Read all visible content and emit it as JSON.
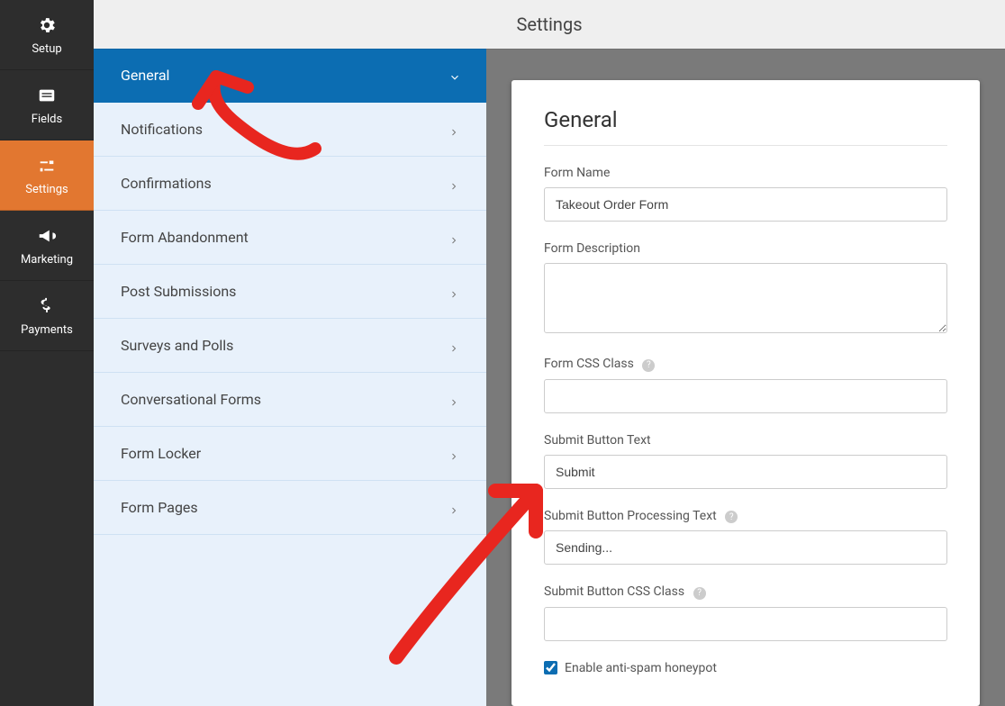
{
  "topbar": {
    "title": "Settings"
  },
  "nav": {
    "items": [
      {
        "label": "Setup"
      },
      {
        "label": "Fields"
      },
      {
        "label": "Settings"
      },
      {
        "label": "Marketing"
      },
      {
        "label": "Payments"
      }
    ]
  },
  "settingsMenu": {
    "items": [
      {
        "label": "General"
      },
      {
        "label": "Notifications"
      },
      {
        "label": "Confirmations"
      },
      {
        "label": "Form Abandonment"
      },
      {
        "label": "Post Submissions"
      },
      {
        "label": "Surveys and Polls"
      },
      {
        "label": "Conversational Forms"
      },
      {
        "label": "Form Locker"
      },
      {
        "label": "Form Pages"
      }
    ]
  },
  "panel": {
    "heading": "General",
    "formName": {
      "label": "Form Name",
      "value": "Takeout Order Form"
    },
    "formDescription": {
      "label": "Form Description",
      "value": ""
    },
    "formCssClass": {
      "label": "Form CSS Class",
      "value": ""
    },
    "submitButtonText": {
      "label": "Submit Button Text",
      "value": "Submit"
    },
    "submitProcessingText": {
      "label": "Submit Button Processing Text",
      "value": "Sending..."
    },
    "submitCssClass": {
      "label": "Submit Button CSS Class",
      "value": ""
    },
    "antispam": {
      "label": "Enable anti-spam honeypot",
      "checked": true
    }
  }
}
